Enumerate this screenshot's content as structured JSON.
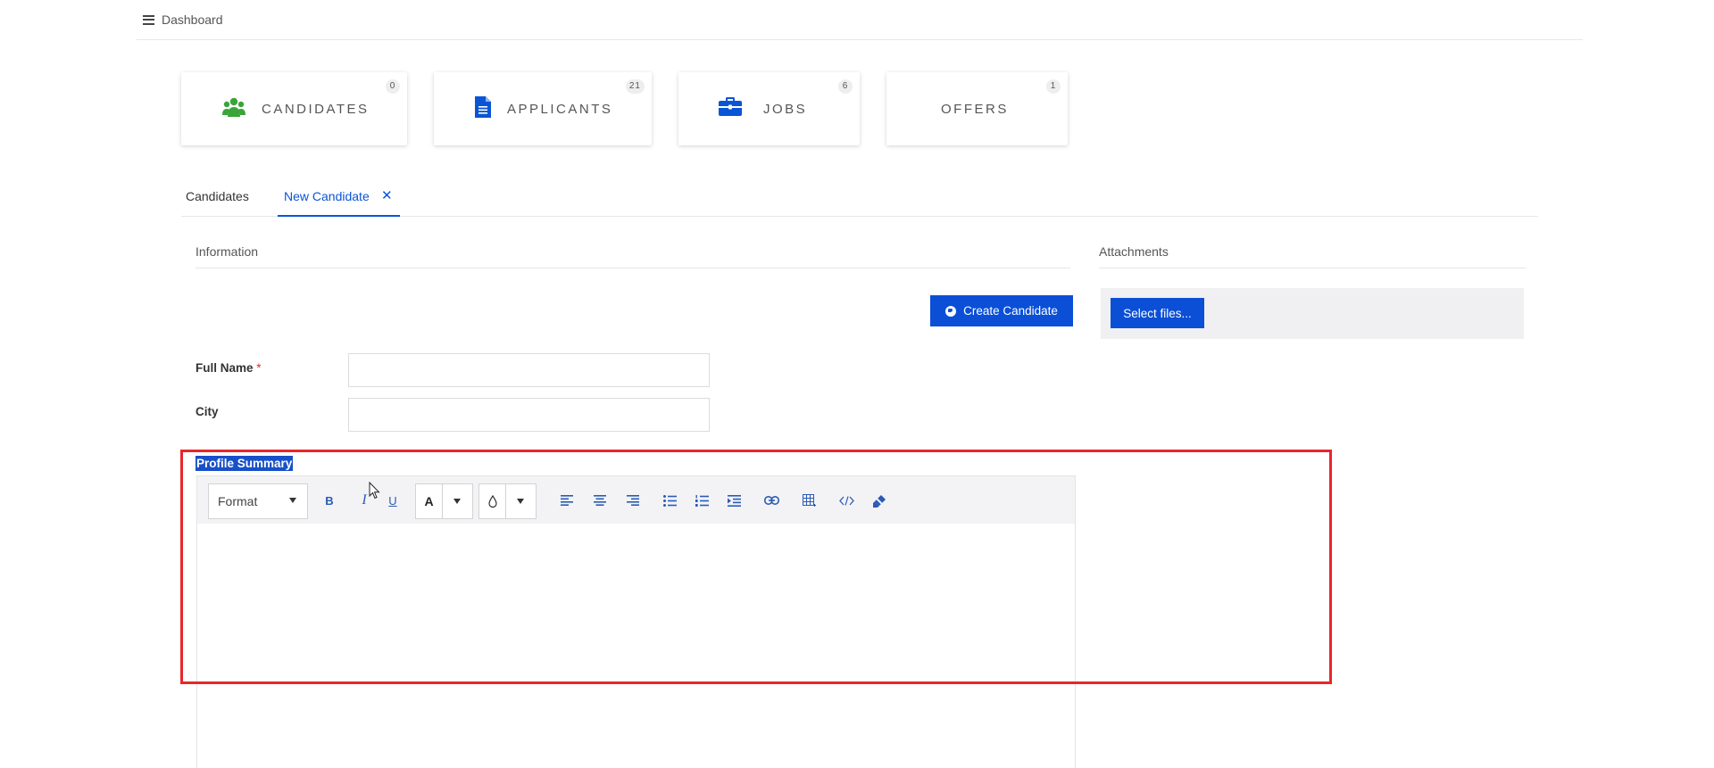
{
  "topbar": {
    "title": "Dashboard",
    "menu_icon": "hamburger-menu-icon"
  },
  "tiles": [
    {
      "label": "CANDIDATES",
      "count": "0",
      "icon": "users-icon",
      "icon_color": "#3aa43a"
    },
    {
      "label": "APPLICANTS",
      "count": "21",
      "icon": "document-icon",
      "icon_color": "#0a55d6"
    },
    {
      "label": "JOBS",
      "count": "6",
      "icon": "briefcase-icon",
      "icon_color": "#0a55d6"
    },
    {
      "label": "OFFERS",
      "count": "1",
      "icon": ""
    }
  ],
  "tabs": [
    {
      "label": "Candidates",
      "active": false
    },
    {
      "label": "New Candidate",
      "active": true,
      "closable": true
    }
  ],
  "sections": {
    "information": "Information",
    "attachments": "Attachments"
  },
  "actions": {
    "create_candidate": "Create Candidate",
    "select_files": "Select files..."
  },
  "form": {
    "full_name": {
      "label": "Full Name",
      "required_mark": "*",
      "value": ""
    },
    "city": {
      "label": "City",
      "value": ""
    },
    "profile_summary": {
      "label": "Profile Summary",
      "value": ""
    }
  },
  "editor_toolbar": {
    "format_label": "Format",
    "font_color_label": "A",
    "buttons": [
      "bold-icon",
      "italic-icon",
      "underline-icon",
      "font-color-icon",
      "background-color-icon",
      "align-left-icon",
      "align-center-icon",
      "align-right-icon",
      "bulleted-list-icon",
      "numbered-list-icon",
      "indent-icon",
      "link-icon",
      "table-icon",
      "view-html-icon",
      "clear-formatting-icon"
    ]
  },
  "colors": {
    "primary": "#0a4fd6",
    "highlight_border": "#e8262b",
    "required": "#d9332b"
  }
}
